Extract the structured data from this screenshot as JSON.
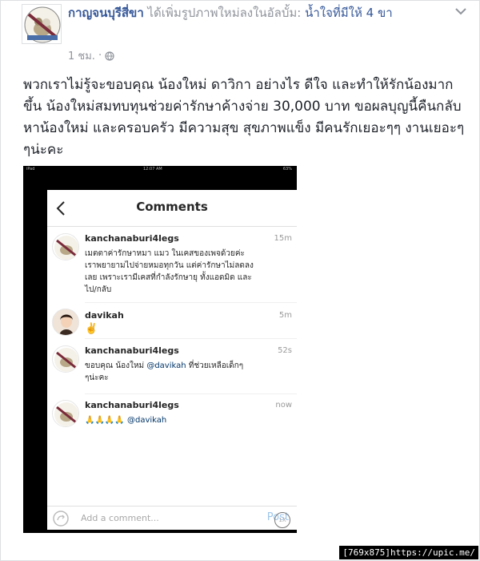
{
  "post": {
    "page_name": "กาญจนบุรีสี่ขา",
    "action_text": " ได้เพิ่มรูปภาพใหม่ลงในอัลบั้ม: ",
    "album_name": "น้ำใจที่มีให้ 4 ขา",
    "time": "1 ชม.",
    "separator": "·",
    "body": "พวกเราไม่รู้จะขอบคุณ น้องใหม่ ดาวิกา อย่างไร ดีใจ และทำให้รักน้องมากขึ้น น้องใหม่สมทบทุนช่วยค่ารักษาค้างจ่าย 30,000 บาท ขอผลบุญนี้คืนกลับหาน้องใหม่ และครอบครัว มีความสุข สุขภาพแข็ง มีคนรักเยอะๆๆ งานเยอะๆๆน่ะคะ"
  },
  "screenshot": {
    "status_left": "iPad",
    "status_time": "12:07 AM",
    "status_battery": "63%",
    "title": "Comments",
    "comments": [
      {
        "user": "kanchanaburi4legs",
        "time": "15m",
        "text": "เมตตาค่ารักษาหมา แมว ในเคสของเพจด้วยค่ะ เราพยายามไปจ่ายหมอทุกวัน แต่ค่ารักษาไม่ลดลงเลย เพราะเรามีเคสที่กำลังรักษายุ ทั้งแอดมิด และไป/กลับ"
      },
      {
        "user": "davikah",
        "time": "5m",
        "text": "✌️"
      },
      {
        "user": "kanchanaburi4legs",
        "time": "52s",
        "text_before": "ขอบคุณ น้องใหม่ ",
        "mention": "@davikah",
        "text_after": " ที่ช่วยเหลือเด็กๆๆน่ะคะ"
      },
      {
        "user": "kanchanaburi4legs",
        "time": "now",
        "emoji": "🙏🙏🙏🙏",
        "mention": "@davikah"
      }
    ],
    "add_placeholder": "Add a comment...",
    "post_label": "Post",
    "speed_label": "1X"
  },
  "watermark": "[769x875]https://upic.me/"
}
